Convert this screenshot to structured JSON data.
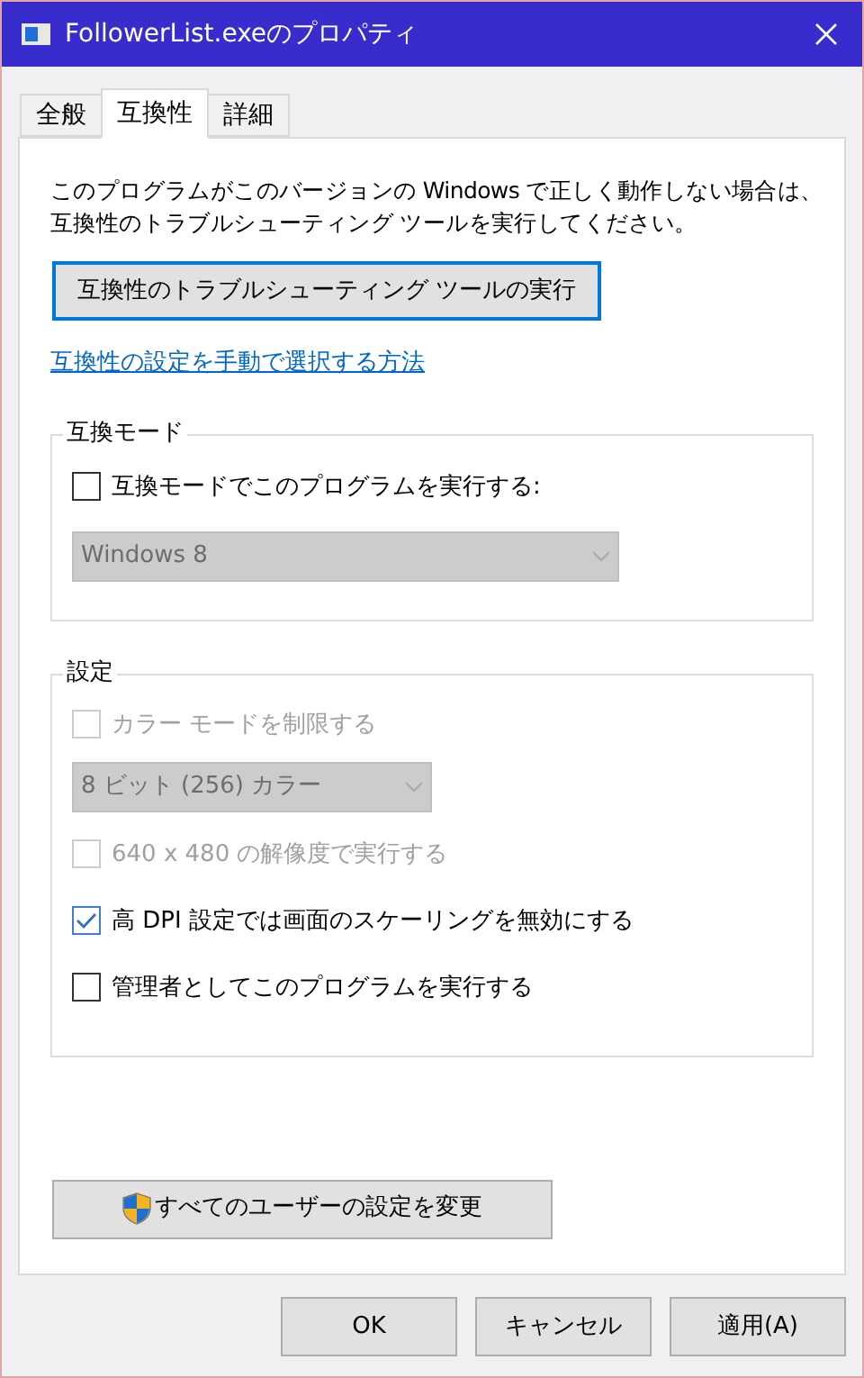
{
  "window": {
    "title": "FollowerList.exeのプロパティ"
  },
  "tabs": [
    {
      "label": "全般",
      "selected": false
    },
    {
      "label": "互換性",
      "selected": true
    },
    {
      "label": "詳細",
      "selected": false
    }
  ],
  "intro": "このプログラムがこのバージョンの Windows で正しく動作しない場合は、互換性のトラブルシューティング ツールを実行してください。",
  "troubleshoot_button": {
    "label": "互換性のトラブルシューティング ツールの実行",
    "focused": true
  },
  "help_link": "互換性の設定を手動で選択する方法",
  "compat_mode": {
    "legend": "互換モード",
    "checkbox": {
      "label": "互換モードでこのプログラムを実行する:",
      "checked": false,
      "disabled": false
    },
    "dropdown": {
      "value": "Windows 8",
      "disabled": true
    }
  },
  "settings": {
    "legend": "設定",
    "items": [
      {
        "kind": "checkbox",
        "label": "カラー モードを制限する",
        "checked": false,
        "disabled": true
      },
      {
        "kind": "dropdown",
        "value": "8 ビット (256) カラー",
        "disabled": true
      },
      {
        "kind": "checkbox",
        "label": "640 x 480 の解像度で実行する",
        "checked": false,
        "disabled": true
      },
      {
        "kind": "checkbox",
        "label": "高 DPI 設定では画面のスケーリングを無効にする",
        "checked": true,
        "disabled": false
      },
      {
        "kind": "checkbox",
        "label": "管理者としてこのプログラムを実行する",
        "checked": false,
        "disabled": false
      }
    ]
  },
  "all_users_button": {
    "label": "すべてのユーザーの設定を変更"
  },
  "buttons": [
    {
      "label": "OK"
    },
    {
      "label": "キャンセル"
    },
    {
      "label": "適用(A)"
    }
  ]
}
